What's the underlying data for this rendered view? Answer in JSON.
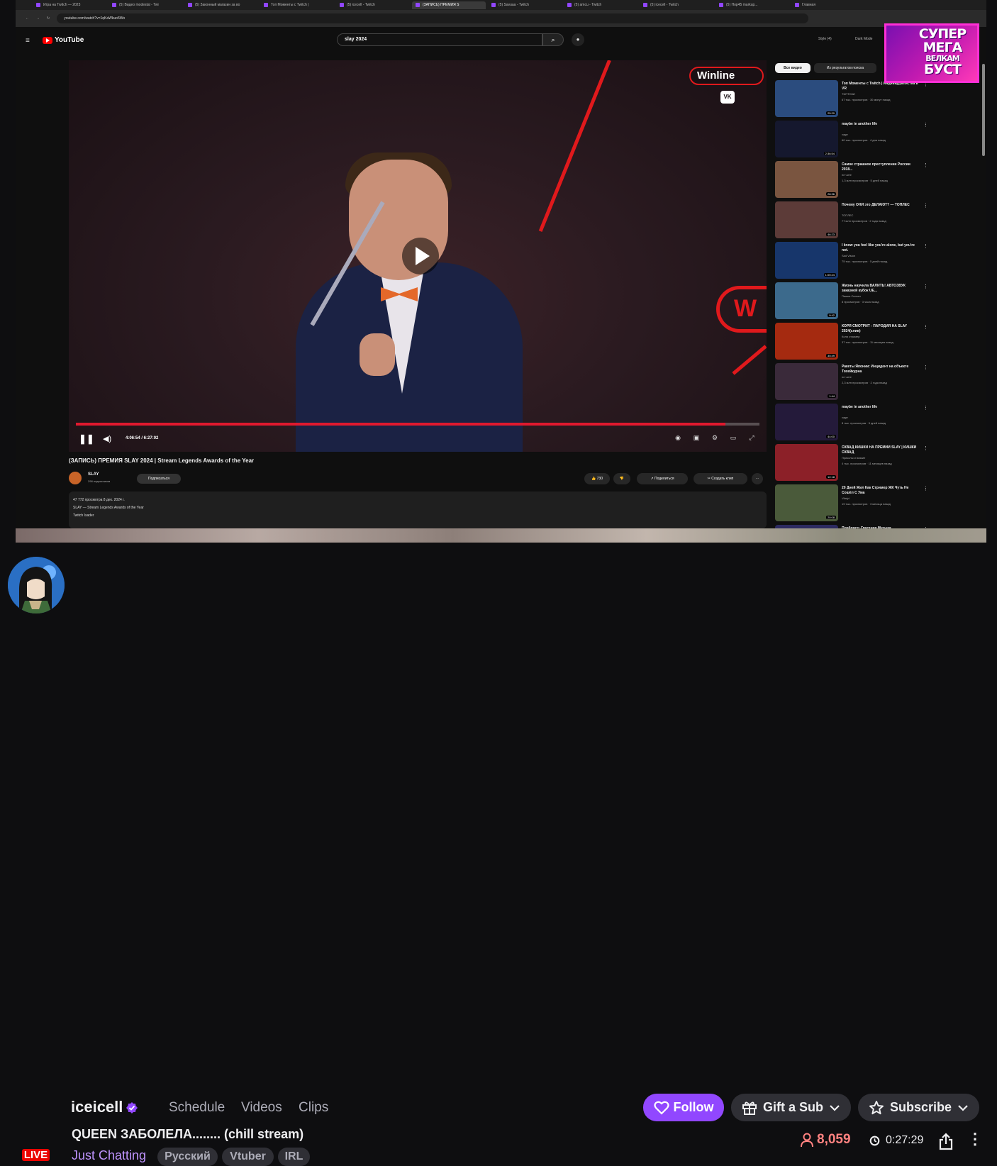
{
  "browser": {
    "tabs": [
      "Игра на Twitch — 2023",
      "(5) Видео modestal - Twi",
      "(5) Законный магазин за во",
      "Топ Моменты с Twitch |",
      "(5) icecell - Twitch",
      "(ЗАПИСЬ) ПРЕМИЯ S",
      "(5) Savuaa - Twitch",
      "(5) amcu - Twitch",
      "(5) icecell - Twitch",
      "(5) Hop45 markup...",
      "Главная"
    ],
    "active_tab_index": 5,
    "url": "youtube.com/watch?v=1qKaWkuo5Wo"
  },
  "youtube": {
    "search_query": "slay 2024",
    "logo_text": "YouTube",
    "style_label": "Style (4)",
    "dark_mode_label": "Dark Mode",
    "video": {
      "time": "4:06:54 / 6:27:02",
      "progress": 0.95,
      "title": "(ЗАПИСЬ) ПРЕМИЯ SLAY 2024 | Stream Legends Awards of the Year",
      "channel": "SLAY",
      "subscribers": "298 подписчиков",
      "subscribe_label": "Подписаться",
      "likes": "730",
      "share_label": "Поделиться",
      "clip_label": "Создать клип",
      "description_line1": "47 772 просмотра  8 дек. 2024 г.",
      "description_line2": "SLAY — Stream Legends Awards of the Year",
      "description_line3": "Twitch Isader",
      "overlay_brand": "Winline",
      "overlay_vk": "VK",
      "overlay_w": "W"
    },
    "chips": {
      "all": "Все видео",
      "results": "Из результатов поиска"
    },
    "recommendations": [
      {
        "title": "Топ Моменты с Twitch | Индивидуалистка в VR",
        "channel": "ТИПТОКИ",
        "meta": "67 тыс. просмотров · 30 минут назад",
        "duration": "25:20",
        "thumb_color": "#2b4c7e"
      },
      {
        "title": "maybe in another life",
        "channel": "xage",
        "meta": "60 тыс. просмотров · 4 дня назад",
        "duration": "2:36:54",
        "thumb_color": "#15182e"
      },
      {
        "title": "Самое страшное преступление России 2018...",
        "channel": "не чите",
        "meta": "1,3 млн просмотров · 5 дней назад",
        "duration": "28:36",
        "thumb_color": "#7a5540"
      },
      {
        "title": "Почему ОНИ это ДЕЛАЮТ? — ТОПЛЕС",
        "channel": "ТОПЛЕС",
        "meta": "77 млн просмотров · 2 года назад",
        "duration": "46:23",
        "thumb_color": "#5c3b38"
      },
      {
        "title": "I know you feel like you're alone, but you're not.",
        "channel": "Sad Vision",
        "meta": "75 тыс. просмотров · 5 дней назад",
        "duration": "1:00:24",
        "thumb_color": "#17366b"
      },
      {
        "title": "Жизнь научила ВАЛИТЬ! АВТОЗВУК заказной кубок UE...",
        "channel": "Пашка Сигнал",
        "meta": "8 просмотров · 3 часа назад",
        "duration": "9:42",
        "thumb_color": "#3c6a8c"
      },
      {
        "title": "КОРЯ СМОТРИТ - ПАРОДИЯ НА SLAY 2024(слив)",
        "channel": "Коля стример",
        "meta": "37 тыс. просмотров · 11 месяцев назад",
        "duration": "35:49",
        "thumb_color": "#a52a10"
      },
      {
        "title": "Ракеты Японии: Инцидент на объекте Тохейкурна",
        "channel": "не чите",
        "meta": "2,3 млн просмотров · 2 года назад",
        "duration": "1:44",
        "thumb_color": "#3a2a3a"
      },
      {
        "title": "maybe in another life",
        "channel": "xage",
        "meta": "8 тыс. просмотров · 5 дней назад",
        "duration": "44:00",
        "thumb_color": "#241a3a"
      },
      {
        "title": "СКВАД КИШКИ НА ПРЕМИИ SLAY | КИШКИ СКВАД",
        "channel": "Приколы и всякие",
        "meta": "4 тыс. просмотров · 11 месяцев назад",
        "duration": "12:18",
        "thumb_color": "#8c2028"
      },
      {
        "title": "20 Дней Жил Как Стример ЖК Чуть Не Сошёл С Ума",
        "channel": "Vitalyi",
        "meta": "19 тыс. просмотров · 3 месяца назад",
        "duration": "20:08",
        "thumb_color": "#4a5a3a"
      },
      {
        "title": "Плейлист: Грустная Музыка",
        "channel": "",
        "meta": "",
        "duration": "",
        "thumb_color": "#2c2a60"
      }
    ]
  },
  "overlay_promo": {
    "line1": "СУПЕР",
    "line2": "МЕГА",
    "line3": "ВЕЛКАМ",
    "line4": "БУСТ"
  },
  "twitch": {
    "channel_name": "iceicell",
    "nav": {
      "schedule": "Schedule",
      "videos": "Videos",
      "clips": "Clips"
    },
    "live_label": "LIVE",
    "stream_title": "QUEEN ЗАБОЛЕЛА........ (chill stream)",
    "category": "Just Chatting",
    "tags": [
      "Русский",
      "Vtuber",
      "IRL"
    ],
    "follow_label": "Follow",
    "gift_label": "Gift a Sub",
    "subscribe_label": "Subscribe",
    "viewers": "8,059",
    "uptime": "0:27:29",
    "colors": {
      "accent": "#9147ff",
      "live": "#eb0400",
      "viewers": "#ff8280",
      "category": "#bf94ff"
    }
  }
}
